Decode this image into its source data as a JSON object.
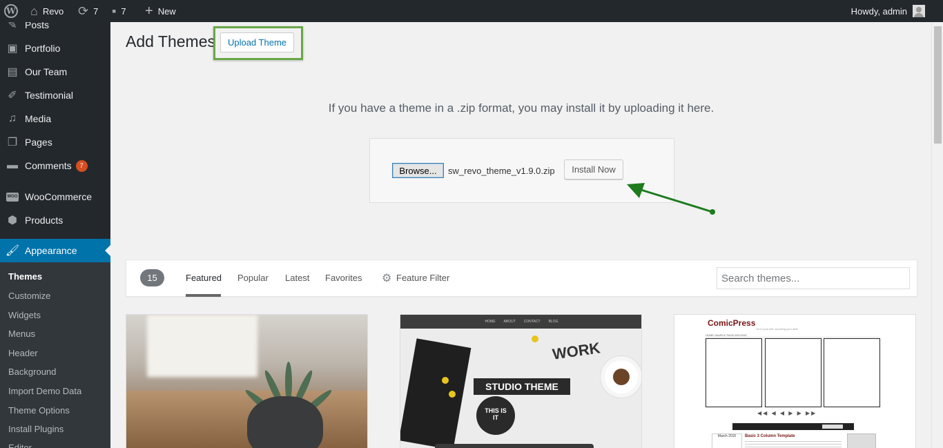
{
  "adminbar": {
    "site_name": "Revo",
    "updates_count": "7",
    "comments_count": "7",
    "new_label": "New",
    "greeting": "Howdy, admin"
  },
  "sidebar": {
    "items": [
      {
        "label": "Posts",
        "icon": "pushpin-icon"
      },
      {
        "label": "Portfolio",
        "icon": "portfolio-icon"
      },
      {
        "label": "Our Team",
        "icon": "team-icon"
      },
      {
        "label": "Testimonial",
        "icon": "edit-icon"
      },
      {
        "label": "Media",
        "icon": "media-icon"
      },
      {
        "label": "Pages",
        "icon": "pages-icon"
      },
      {
        "label": "Comments",
        "icon": "comment-icon",
        "badge": "7"
      },
      {
        "label": "WooCommerce",
        "icon": "woocommerce-icon"
      },
      {
        "label": "Products",
        "icon": "products-icon"
      },
      {
        "label": "Appearance",
        "icon": "appearance-icon",
        "current": true
      }
    ],
    "submenu": [
      {
        "label": "Themes",
        "active": true
      },
      {
        "label": "Customize"
      },
      {
        "label": "Widgets"
      },
      {
        "label": "Menus"
      },
      {
        "label": "Header"
      },
      {
        "label": "Background"
      },
      {
        "label": "Import Demo Data"
      },
      {
        "label": "Theme Options"
      },
      {
        "label": "Install Plugins"
      },
      {
        "label": "Editor"
      }
    ]
  },
  "page": {
    "title": "Add Themes",
    "upload_button": "Upload Theme",
    "upload_help": "If you have a theme in a .zip format, you may install it by uploading it here.",
    "browse_button": "Browse...",
    "file_name": "sw_revo_theme_v1.9.0.zip",
    "install_button": "Install Now"
  },
  "filter": {
    "count": "15",
    "tabs": [
      "Featured",
      "Popular",
      "Latest",
      "Favorites"
    ],
    "active_tab": "Featured",
    "feature_filter": "Feature Filter",
    "search_placeholder": "Search themes..."
  },
  "themes": [
    {
      "preview": "plant-photo"
    },
    {
      "preview": "studio",
      "nav": [
        "HOME",
        "ABOUT",
        "CONTACT",
        "BLOG"
      ],
      "title": "STUDIO THEME",
      "tagline": "WORK",
      "circle_text": "THIS IS IT"
    },
    {
      "preview": "comicpress",
      "title": "ComicPress",
      "subtitle": "I'm in your site. touching your stuff.",
      "nav": "HOME   SAMPLE PAGE   ARCHIVE",
      "post_title": "Basic 3 Column Template",
      "calendar": "March 2015"
    }
  ],
  "colors": {
    "admin_dark": "#23282d",
    "accent_blue": "#0073aa",
    "highlight_green": "#69a746",
    "arrow_green": "#1e7b1e",
    "badge_orange": "#d54e21"
  }
}
